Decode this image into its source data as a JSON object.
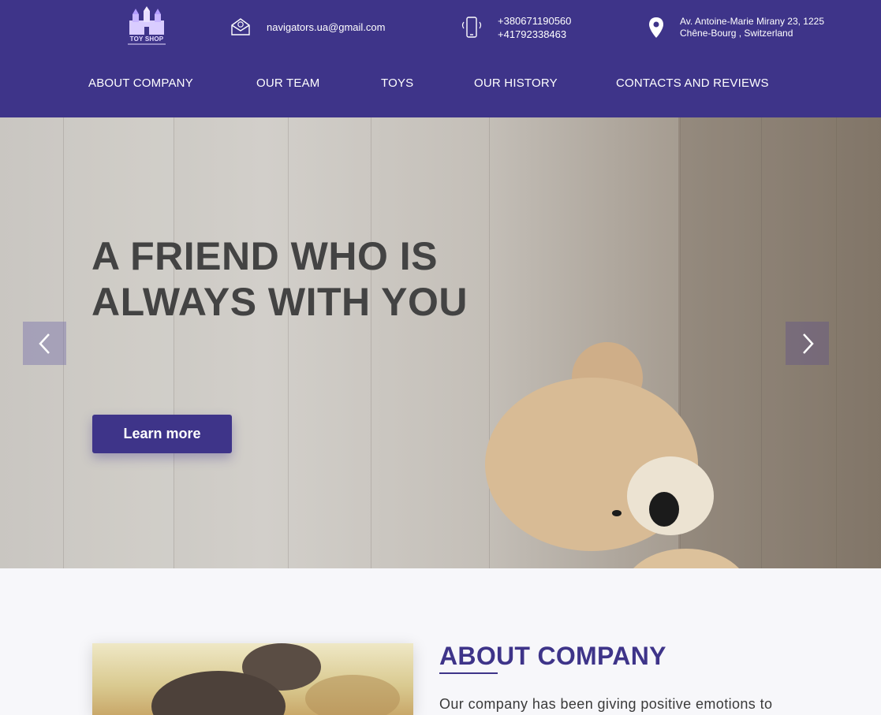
{
  "brand": {
    "logo_text": "TOY SHOP",
    "accent_color": "#3e3489"
  },
  "header": {
    "email": {
      "icon": "envelope-icon",
      "text": "navigators.ua@gmail.com"
    },
    "phone": {
      "icon": "mobile-phone-icon",
      "lines": [
        "+380671190560",
        "+41792338463"
      ]
    },
    "address": {
      "icon": "location-pin-icon",
      "lines": [
        "Av. Antoine-Marie Mirany 23, 1225",
        "Chêne-Bourg , Switzerland"
      ]
    }
  },
  "nav": {
    "items": [
      {
        "label": "ABOUT COMPANY"
      },
      {
        "label": "OUR TEAM"
      },
      {
        "label": "TOYS"
      },
      {
        "label": "OUR HISTORY"
      },
      {
        "label": "CONTACTS AND REVIEWS"
      }
    ]
  },
  "hero": {
    "title_lines": [
      "A FRIEND WHO IS",
      "ALWAYS WITH YOU"
    ],
    "button_label": "Learn more",
    "prev_icon": "chevron-left-icon",
    "next_icon": "chevron-right-icon"
  },
  "about": {
    "title": "ABOUT COMPANY",
    "text": "Our company has been giving positive emotions to"
  }
}
